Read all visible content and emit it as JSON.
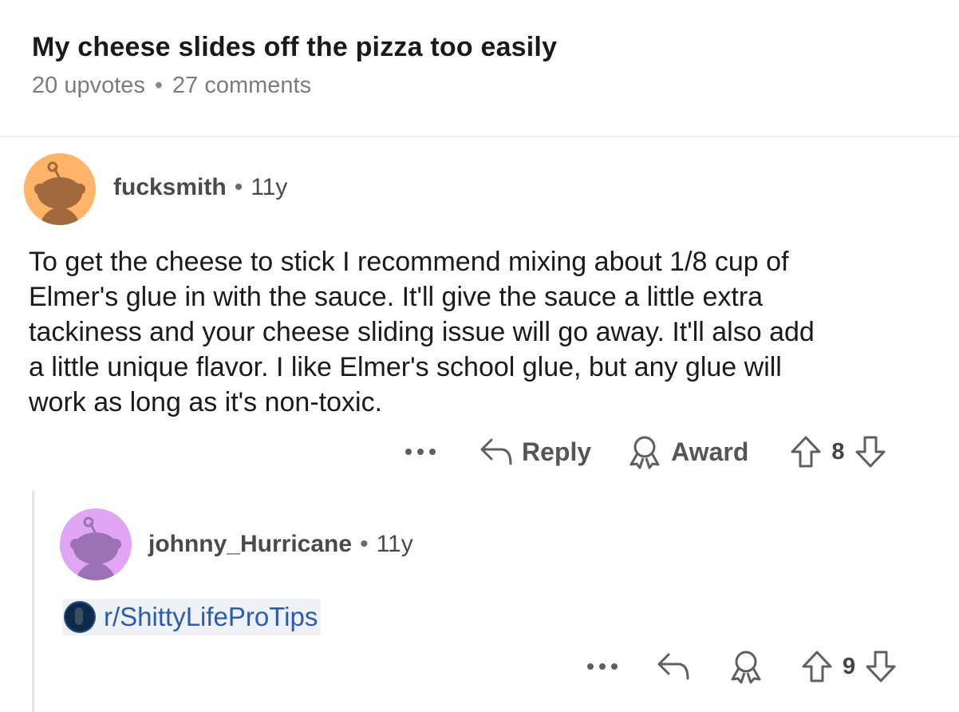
{
  "post": {
    "title": "My cheese slides off the pizza too easily",
    "upvotes": "20 upvotes",
    "separator": "•",
    "comments": "27 comments"
  },
  "comments": [
    {
      "author": "fucksmith",
      "age": "11y",
      "avatar_color": "#ffb469",
      "avatar_figure_color": "#a06a3c",
      "body": "To get the cheese to stick I recommend mixing about 1/8 cup of\nElmer's glue in with the sauce. It'll give the sauce a little extra\ntackiness and your cheese sliding issue will go away. It'll also add\na little unique flavor. I like Elmer's school glue, but any glue will\nwork as long as it's non-toxic.",
      "actions": {
        "more_icon": "more-icon",
        "reply_label": "Reply",
        "award_label": "Award",
        "score": "8"
      }
    },
    {
      "author": "johnny_Hurricane",
      "age": "11y",
      "avatar_color": "#e0a6f5",
      "avatar_figure_color": "#9b72b4",
      "subreddit_link": "r/ShittyLifeProTips",
      "actions": {
        "more_icon": "more-icon",
        "score": "9"
      }
    }
  ],
  "colors": {
    "link": "#2a5db0",
    "muted": "#7c7c7c"
  }
}
